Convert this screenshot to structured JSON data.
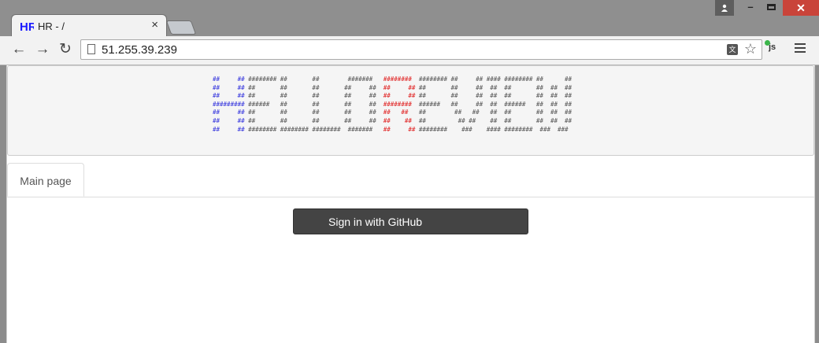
{
  "browser": {
    "tab_title": "HR - /",
    "tab_close": "×",
    "favicon_text": "HR",
    "url": "51.255.39.239",
    "window": {
      "profile_icon": "person-icon",
      "minimize": "–",
      "close": "✕"
    },
    "toolbar": {
      "back": "←",
      "forward": "→",
      "reload": "↻",
      "star": "☆",
      "translate": "文",
      "extension": "js"
    }
  },
  "banner": {
    "ascii_lines": [
      [
        "##     ## ",
        "######## ##       ##        #######   ",
        "######## ",
        " ######## ##     ## #### ######## ##      ##"
      ],
      [
        "##     ## ",
        "##       ##       ##       ##     ##  ",
        "##     ##",
        " ##       ##     ##  ##  ##       ##  ##  ##"
      ],
      [
        "##     ## ",
        "##       ##       ##       ##     ##  ",
        "##     ##",
        " ##       ##     ##  ##  ##       ##  ##  ##"
      ],
      [
        "######### ",
        "######   ##       ##       ##     ##  ",
        "######## ",
        " ######   ##     ##  ##  ######   ##  ##  ##"
      ],
      [
        "##     ## ",
        "##       ##       ##       ##     ##  ",
        "##   ##  ",
        " ##        ##   ##   ##  ##       ##  ##  ##"
      ],
      [
        "##     ## ",
        "##       ##       ##       ##     ##  ",
        "##    ## ",
        " ##         ## ##    ##  ##       ##  ##  ##"
      ],
      [
        "##     ## ",
        "######## ######## ########  #######   ",
        "##     ##",
        " ########    ###    #### ########  ###  ###"
      ]
    ]
  },
  "nav": {
    "tabs": [
      {
        "label": "Main page"
      }
    ]
  },
  "main": {
    "signin_label": "Sign in with GitHub"
  },
  "colors": {
    "ascii_blue": "#3333dd",
    "ascii_red": "#e02020",
    "button_bg": "#444444"
  }
}
